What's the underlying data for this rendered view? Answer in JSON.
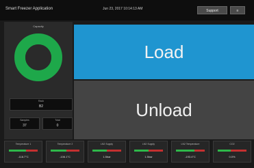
{
  "header": {
    "app_title": "Smart Freezer Application",
    "datetime": "Jun 23, 2017 10:14:13 AM",
    "support_label": "Support",
    "menu_label": "≡"
  },
  "left_panel": {
    "gauge_label": "Capacity",
    "gauge_color": "#1ea84a",
    "gauge_value": "",
    "field_main": {
      "label": "Rack",
      "value": "B2"
    },
    "field_left": {
      "label": "Samples",
      "value": "37"
    },
    "field_right": {
      "label": "Total",
      "value": "0"
    }
  },
  "actions": {
    "load_label": "Load",
    "unload_label": "Unload",
    "load_color": "#1f95d0",
    "unload_color": "#444444"
  },
  "metrics": [
    {
      "title": "Temperature 1",
      "value": "-118.7°C",
      "level": 0.6
    },
    {
      "title": "Temperature 2",
      "value": "-106.1°C",
      "level": 0.55
    },
    {
      "title": "LN2 Supply",
      "value": "1.5bar",
      "level": 0.5
    },
    {
      "title": "LN2 Supply",
      "value": "1.5bar",
      "level": 0.5
    },
    {
      "title": "LN2 Temperature",
      "value": "-193.4°C",
      "level": 0.65
    },
    {
      "title": "CO2",
      "value": "0.0%",
      "level": 0.45
    }
  ]
}
